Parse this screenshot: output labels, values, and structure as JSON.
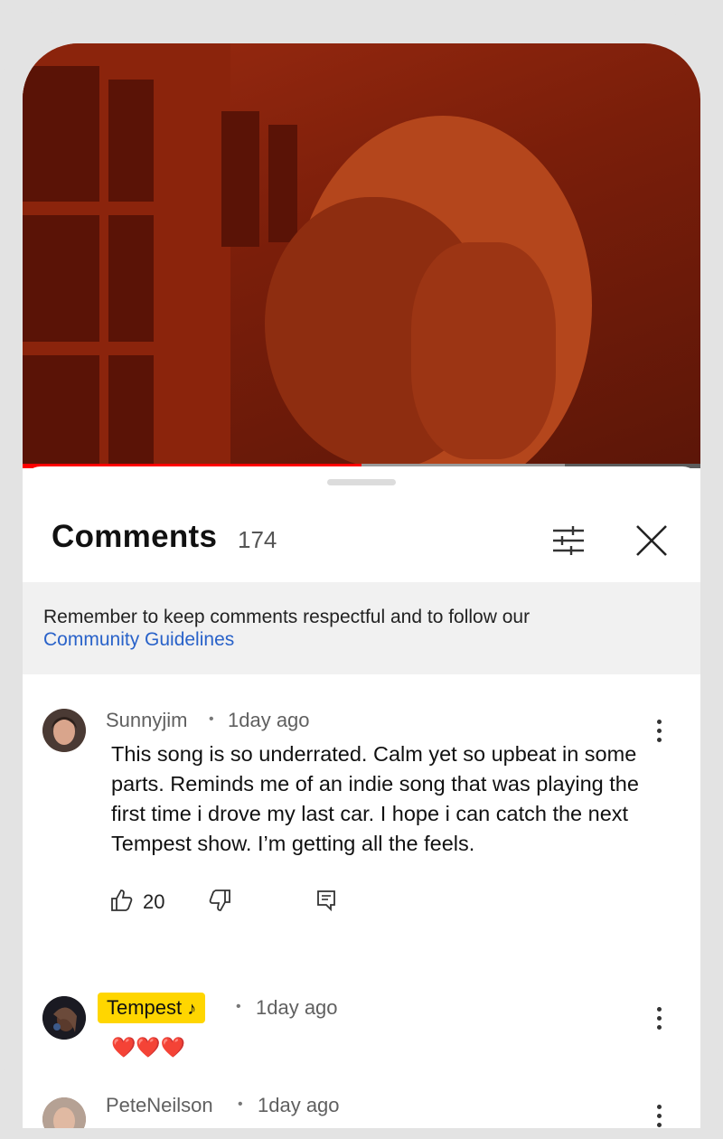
{
  "sheet": {
    "title": "Comments",
    "count": "174",
    "filter_icon": "filter-sliders-icon",
    "close_icon": "close-icon"
  },
  "banner": {
    "text": "Remember to keep comments respectful and to follow our",
    "link": "Community Guidelines"
  },
  "comments": [
    {
      "author": "Sunnyjim",
      "time": "1day ago",
      "text": "This song is so underrated. Calm yet so upbeat in some parts. Reminds me of an indie song that was playing the first time i drove my last car. I hope i can catch the next Tempest show. I’m getting all the feels.",
      "likes": "20"
    },
    {
      "author": "Tempest",
      "author_badge_icon": "music-note-icon",
      "time": "1day ago",
      "text": "❤️❤️❤️"
    },
    {
      "author": "PeteNeilson",
      "time": "1day ago"
    }
  ],
  "colors": {
    "progress": "#ff0000",
    "link": "#2962c9",
    "creator_badge": "#ffd600"
  },
  "video": {
    "progress_fraction": 0.5
  }
}
